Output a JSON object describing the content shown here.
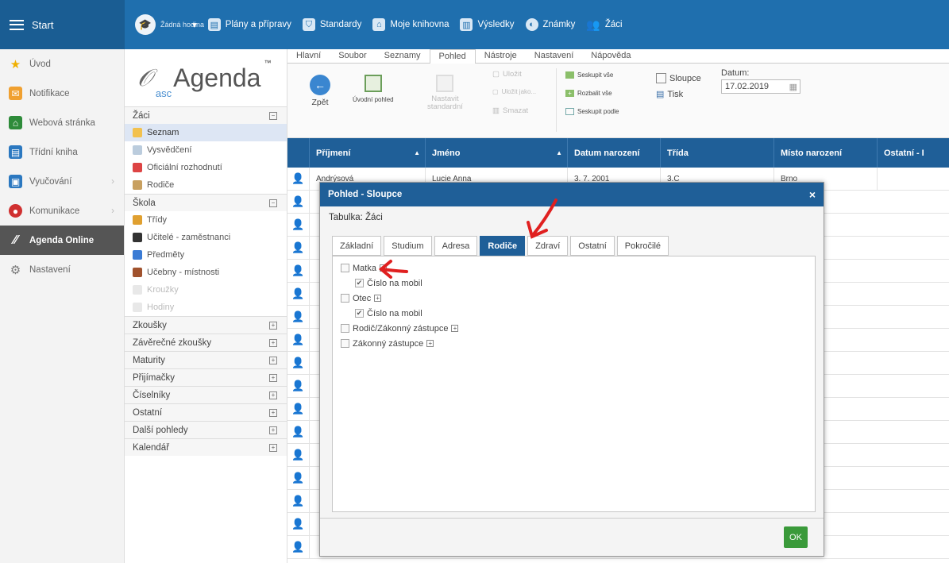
{
  "topbar": {
    "start_label": "Start",
    "lesson_label": "Žádná hodina",
    "items": [
      "Plány a přípravy",
      "Standardy",
      "Moje knihovna",
      "Výsledky",
      "Známky",
      "Žáci"
    ]
  },
  "leftnav": {
    "items": [
      {
        "label": "Úvod"
      },
      {
        "label": "Notifikace"
      },
      {
        "label": "Webová stránka"
      },
      {
        "label": "Třídní kniha"
      },
      {
        "label": "Vyučování"
      },
      {
        "label": "Komunikace"
      },
      {
        "label": "Agenda Online"
      },
      {
        "label": "Nastavení"
      }
    ]
  },
  "logo": {
    "asc": "asc",
    "agenda": "Agenda",
    "tm": "™"
  },
  "sidepanel": {
    "zaci": {
      "title": "Žáci",
      "items": [
        "Seznam",
        "Vysvědčení",
        "Oficiální rozhodnutí",
        "Rodiče"
      ]
    },
    "skola": {
      "title": "Škola",
      "items": [
        "Třídy",
        "Učitelé - zaměstnanci",
        "Předměty",
        "Učebny - místnosti",
        "Kroužky",
        "Hodiny"
      ]
    },
    "sections": [
      "Zkoušky",
      "Závěrečné zkoušky",
      "Maturity",
      "Přijímačky",
      "Číselníky",
      "Ostatní",
      "Další pohledy",
      "Kalendář"
    ]
  },
  "menu": {
    "tabs": [
      "Hlavní",
      "Soubor",
      "Seznamy",
      "Pohled",
      "Nástroje",
      "Nastavení",
      "Nápověda"
    ],
    "active": "Pohled"
  },
  "ribbon": {
    "back": "Zpět",
    "home_view": "Úvodní pohled",
    "set_standard_1": "Nastavit",
    "set_standard_2": "standardní",
    "save": "Uložit",
    "save_as": "Uložit jako...",
    "delete": "Smazat",
    "group_all": "Seskupit vše",
    "expand_all": "Rozbalit vše",
    "group_by": "Seskupit podle",
    "columns": "Sloupce",
    "print": "Tisk",
    "date_label": "Datum:",
    "date_value": "17.02.2019"
  },
  "grid": {
    "columns": [
      "Příjmení",
      "Jméno",
      "Datum narození",
      "Třída",
      "Místo narození",
      "Ostatní - I"
    ],
    "first_row": [
      "Andrýsová",
      "Lucie Anna",
      "3. 7. 2001",
      "3.C",
      "Brno"
    ]
  },
  "dialog": {
    "title": "Pohled - Sloupce",
    "close": "×",
    "table_label": "Tabulka: Žáci",
    "tabs": [
      "Základní",
      "Studium",
      "Adresa",
      "Rodiče",
      "Zdraví",
      "Ostatní",
      "Pokročilé"
    ],
    "active_tab": "Rodiče",
    "tree": [
      {
        "label": "Matka",
        "checked": false,
        "expand": true,
        "level": 0
      },
      {
        "label": "Číslo na mobil",
        "checked": true,
        "expand": false,
        "level": 1
      },
      {
        "label": "Otec",
        "checked": false,
        "expand": true,
        "level": 0
      },
      {
        "label": "Číslo na mobil",
        "checked": true,
        "expand": false,
        "level": 1
      },
      {
        "label": "Rodič/Zákonný zástupce",
        "checked": false,
        "expand": true,
        "level": 0
      },
      {
        "label": "Zákonný zástupce",
        "checked": false,
        "expand": true,
        "level": 0
      }
    ],
    "ok": "OK"
  },
  "colors": {
    "primary": "#1f5f98",
    "topbar": "#1f6fae",
    "ok": "#3a9a3a",
    "annotation": "#e02020"
  }
}
